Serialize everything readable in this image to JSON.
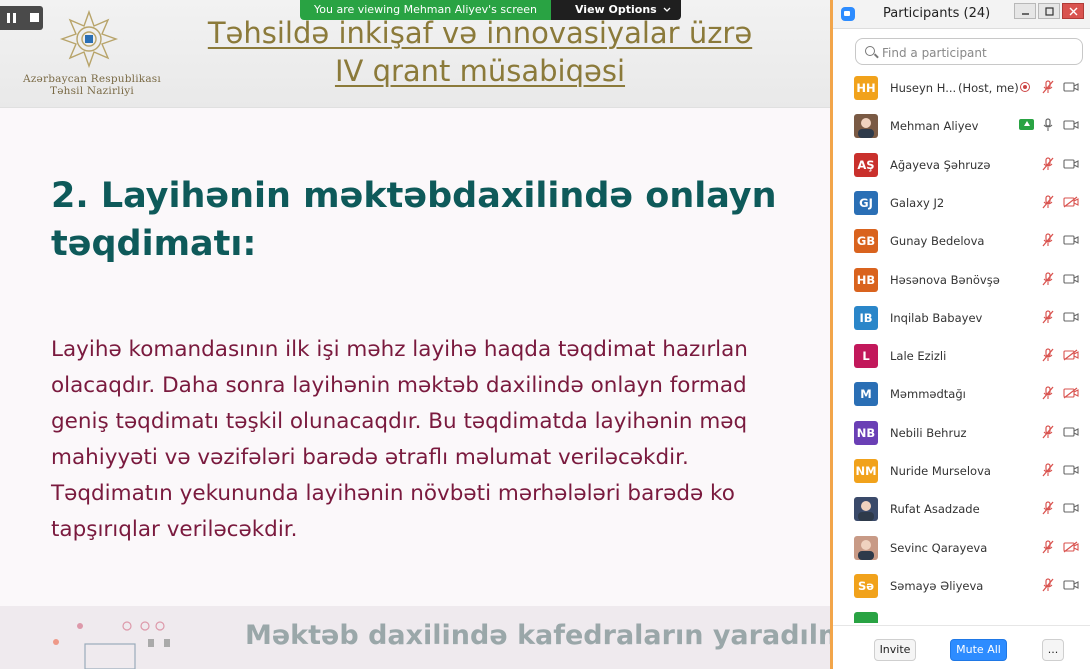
{
  "slide": {
    "logo_line1": "Azərbaycan Respublikası",
    "logo_line2": "Təhsil Nazirliyi",
    "header_line1": "Təhsildə inkişaf və innovasiyalar üzrə",
    "header_line2": "IV qrant müsabiqəsi",
    "heading_line1": "2. Layihənin məktəbdaxilində onlayn",
    "heading_line2": "təqdimatı:",
    "body_lines": [
      "Layihə komandasının ilk işi məhz layihə haqda təqdimat hazırlan",
      "olacaqdır. Daha sonra layihənin məktəb daxilində onlayn formad",
      "geniş təqdimatı təşkil olunacaqdır. Bu təqdimatda layihənin məq",
      "mahiyyəti və vəzifələri barədə ətraflı məlumat veriləcəkdir.",
      "Təqdimatın yekununda layihənin növbəti mərhələləri barədə ko",
      "tapşırıqlar veriləcəkdir."
    ],
    "footer_text": "Məktəb daxilində kafedraların yaradılm",
    "colors": {
      "header": "#8b7a3a",
      "heading": "#0e5a5a",
      "body": "#7a1a3e"
    }
  },
  "share_bar": {
    "message": "You are viewing Mehman Aliyev's screen",
    "view_options": "View Options",
    "color": "#29a343"
  },
  "panel": {
    "title": "Participants (24)",
    "search_placeholder": "Find a participant",
    "invite_label": "Invite",
    "mute_all_label": "Mute All",
    "more_label": "...",
    "participants": [
      {
        "initials": "HH",
        "name": "Huseyn H...",
        "status": "(Host, me)",
        "color": "#f1a21b",
        "mic": "muted",
        "cam": "on",
        "extra": "record-icon"
      },
      {
        "initials": "",
        "name": "Mehman Aliyev",
        "status": "",
        "color": "photo",
        "mic": "on",
        "cam": "on",
        "extra": "share-screen-icon"
      },
      {
        "initials": "AŞ",
        "name": "Ağayeva Şəhruzə",
        "status": "",
        "color": "#c9302c",
        "mic": "muted",
        "cam": "on",
        "extra": ""
      },
      {
        "initials": "GJ",
        "name": "Galaxy J2",
        "status": "",
        "color": "#2a6fb5",
        "mic": "muted",
        "cam": "off",
        "extra": ""
      },
      {
        "initials": "GB",
        "name": "Gunay Bedelova",
        "status": "",
        "color": "#d9631e",
        "mic": "muted",
        "cam": "on",
        "extra": ""
      },
      {
        "initials": "HB",
        "name": "Həsənova Bənövşə",
        "status": "",
        "color": "#d9631e",
        "mic": "muted",
        "cam": "on",
        "extra": ""
      },
      {
        "initials": "IB",
        "name": "Inqilab Babayev",
        "status": "",
        "color": "#2a86c9",
        "mic": "muted",
        "cam": "on",
        "extra": ""
      },
      {
        "initials": "L",
        "name": "Lale Ezizli",
        "status": "",
        "color": "#c2185b",
        "mic": "muted",
        "cam": "off",
        "extra": ""
      },
      {
        "initials": "M",
        "name": "Məmmədtağı",
        "status": "",
        "color": "#2a6fb5",
        "mic": "muted",
        "cam": "off",
        "extra": ""
      },
      {
        "initials": "NB",
        "name": "Nebili Behruz",
        "status": "",
        "color": "#6a3fb5",
        "mic": "muted",
        "cam": "on",
        "extra": ""
      },
      {
        "initials": "NM",
        "name": "Nuride Murselova",
        "status": "",
        "color": "#f1a21b",
        "mic": "muted",
        "cam": "on",
        "extra": ""
      },
      {
        "initials": "",
        "name": "Rufat Asadzade",
        "status": "",
        "color": "photo",
        "mic": "muted",
        "cam": "on",
        "extra": ""
      },
      {
        "initials": "",
        "name": "Sevinc Qarayeva",
        "status": "",
        "color": "photo",
        "mic": "muted",
        "cam": "off",
        "extra": ""
      },
      {
        "initials": "Sə",
        "name": "Səmayə Əliyeva",
        "status": "",
        "color": "#f1a21b",
        "mic": "muted",
        "cam": "on",
        "extra": ""
      }
    ]
  }
}
